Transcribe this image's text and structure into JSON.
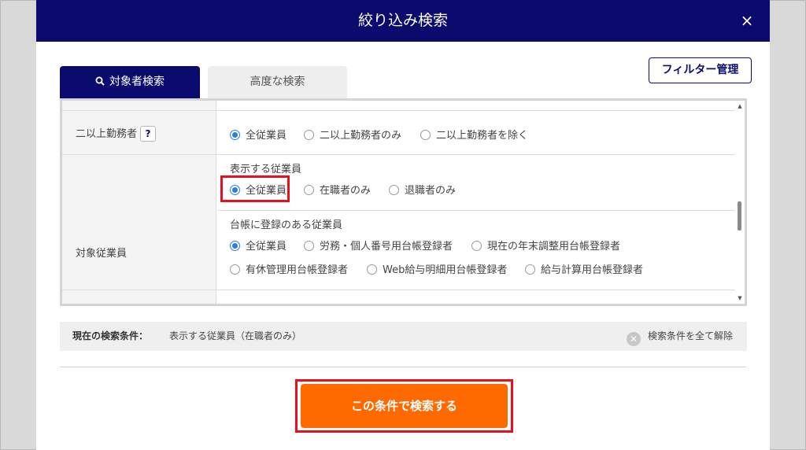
{
  "dialog": {
    "title": "絞り込み検索",
    "close_label": "×"
  },
  "tabs": [
    {
      "label": "対象者検索",
      "active": true
    },
    {
      "label": "高度な検索",
      "active": false
    }
  ],
  "filter_manage_label": "フィルター管理",
  "fields": {
    "multi_employer": {
      "label": "二以上勤務者",
      "help_label": "?",
      "options": [
        "全従業員",
        "二以上勤務者のみ",
        "二以上勤務者を除く"
      ],
      "selected": "全従業員"
    },
    "target_employees": {
      "label": "対象従業員",
      "display": {
        "title": "表示する従業員",
        "options": [
          "全従業員",
          "在職者のみ",
          "退職者のみ"
        ],
        "selected": "全従業員"
      },
      "ledger": {
        "title": "台帳に登録のある従業員",
        "options": [
          "全従業員",
          "労務・個人番号用台帳登録者",
          "現在の年末調整用台帳登録者",
          "有休管理用台帳登録者",
          "Web給与明細用台帳登録者",
          "給与計算用台帳登録者"
        ],
        "selected": "全従業員"
      }
    }
  },
  "conditions": {
    "label": "現在の検索条件：",
    "value": "表示する従業員（在職者のみ）",
    "clear_label": "検索条件を全て解除"
  },
  "search_button_label": "この条件で検索する",
  "colors": {
    "header": "#0b0b6e",
    "accent_radio": "#2a7de1",
    "search_button": "#ff6a00",
    "highlight": "#e8101e"
  }
}
